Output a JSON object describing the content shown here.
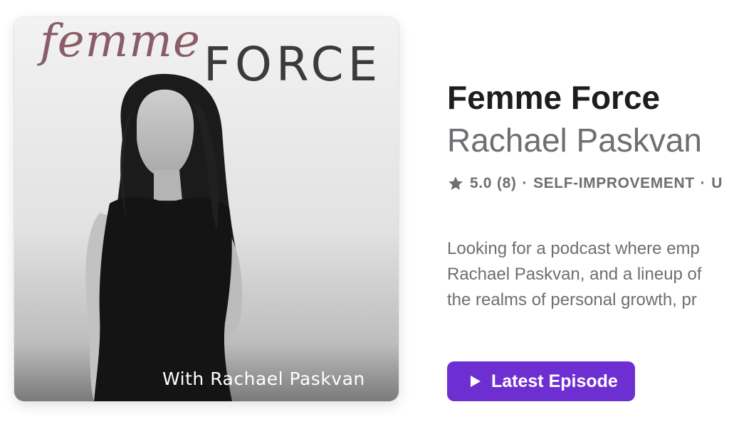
{
  "artwork": {
    "script_title": "femme",
    "caps_title": "FORCE",
    "byline": "With Rachael Paskvan"
  },
  "show": {
    "title": "Femme Force",
    "author": "Rachael Paskvan",
    "rating": "5.0",
    "rating_count": "(8)",
    "category": "SELF-IMPROVEMENT",
    "meta_trailing": "U",
    "separator": "·"
  },
  "description": {
    "lines": [
      "Looking for a podcast where emp",
      "Rachael Paskvan, and a lineup of",
      "the realms of personal growth, pr"
    ]
  },
  "actions": {
    "latest_episode_label": "Latest Episode"
  },
  "colors": {
    "accent": "#6e2fd2",
    "title_text": "#1d1d1f",
    "secondary_text": "#6e6e73",
    "script_title_color": "#8a5d68"
  },
  "icons": {
    "rating_icon": "star-icon",
    "button_icon": "play-icon"
  }
}
